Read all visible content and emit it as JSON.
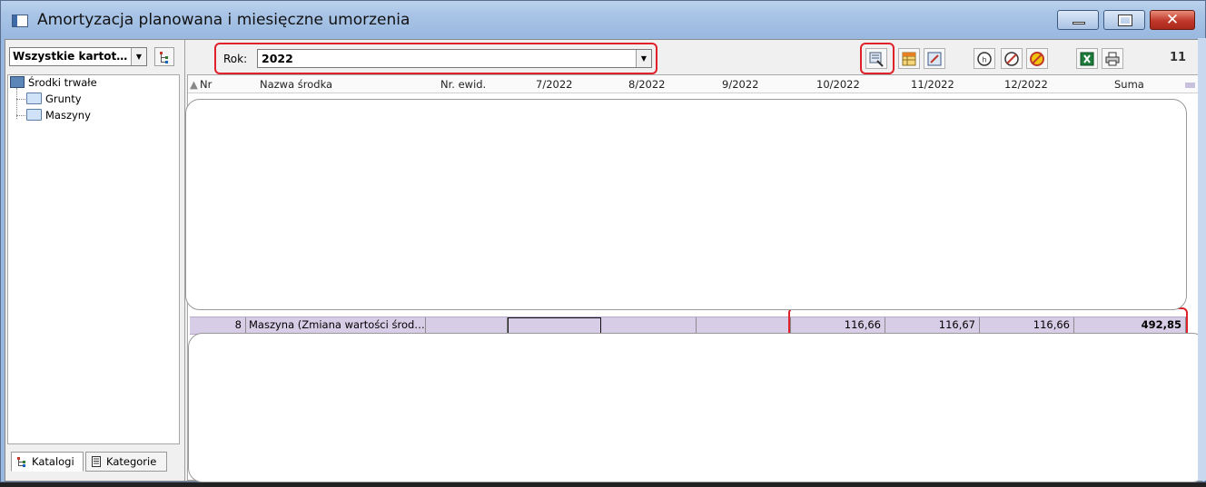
{
  "window": {
    "title": "Amortyzacja planowana i miesięczne umorzenia"
  },
  "left_panel": {
    "filter_value": "Wszystkie kartot…",
    "tree": [
      {
        "label": "Środki trwałe",
        "icon": "computer-icon"
      },
      {
        "label": "Grunty",
        "icon": "folder-icon"
      },
      {
        "label": "Maszyny",
        "icon": "folder-icon"
      }
    ],
    "tabs": [
      {
        "label": "Katalogi",
        "icon": "tree-icon",
        "active": true
      },
      {
        "label": "Kategorie",
        "icon": "document-icon",
        "active": false
      }
    ]
  },
  "toolbar": {
    "year_label": "Rok:",
    "year_value": "2022",
    "count": "11",
    "icons": [
      "calculate-icon",
      "table-icon",
      "edit-icon",
      "history-icon",
      "clear-icon",
      "cancel-icon",
      "excel-icon",
      "print-icon"
    ]
  },
  "grid": {
    "columns": [
      "Nr",
      "Nazwa środka",
      "Nr. ewid.",
      "7/2022",
      "8/2022",
      "9/2022",
      "10/2022",
      "11/2022",
      "12/2022",
      "Suma"
    ],
    "row": {
      "nr": "8",
      "name": "Maszyna (Zmiana wartości środ…",
      "ewid": "",
      "m7": "",
      "m8": "",
      "m9": "",
      "m10": "116,66",
      "m11": "116,67",
      "m12": "116,66",
      "suma": "492,85"
    }
  },
  "colors": {
    "highlight": "#e0202a",
    "row_bg": "#d8cde6"
  }
}
